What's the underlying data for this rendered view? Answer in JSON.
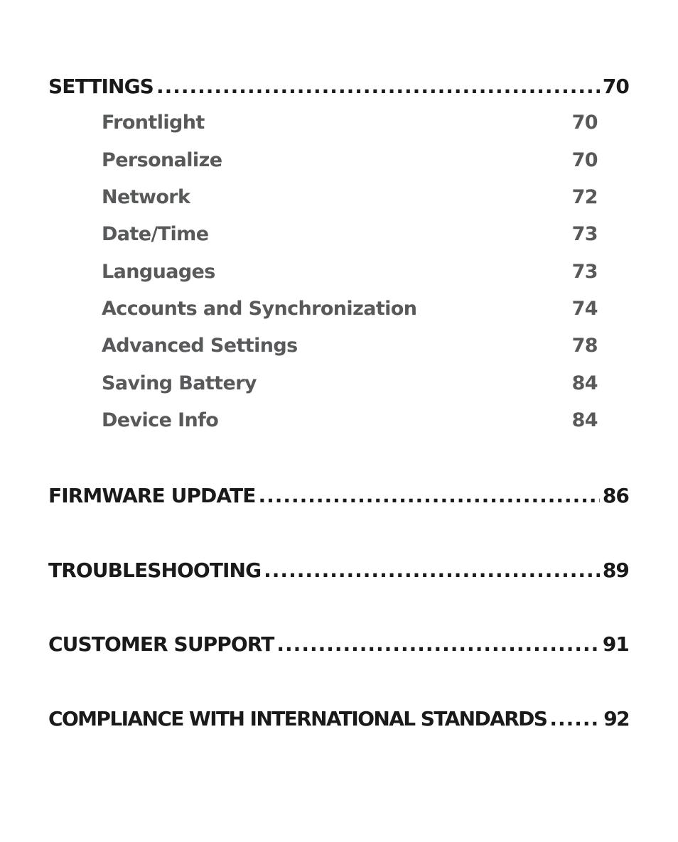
{
  "toc": {
    "settings": {
      "title": "SETTINGS",
      "page": "70",
      "items": [
        {
          "title": "Frontlight",
          "page": "70"
        },
        {
          "title": "Personalize",
          "page": "70"
        },
        {
          "title": "Network",
          "page": "72"
        },
        {
          "title": "Date/Time",
          "page": "73"
        },
        {
          "title": "Languages",
          "page": "73"
        },
        {
          "title": "Accounts and Synchronization",
          "page": "74"
        },
        {
          "title": "Advanced Settings",
          "page": "78"
        },
        {
          "title": "Saving Battery",
          "page": "84"
        },
        {
          "title": "Device Info",
          "page": "84"
        }
      ]
    },
    "firmware_update": {
      "title": "FIRMWARE UPDATE",
      "page": "86"
    },
    "troubleshooting": {
      "title": "TROUBLESHOOTING",
      "page": "89"
    },
    "customer_support": {
      "title": "CUSTOMER SUPPORT",
      "page": "91"
    },
    "compliance": {
      "title": "COMPLIANCE WITH INTERNATIONAL STANDARDS",
      "page": "92"
    }
  }
}
